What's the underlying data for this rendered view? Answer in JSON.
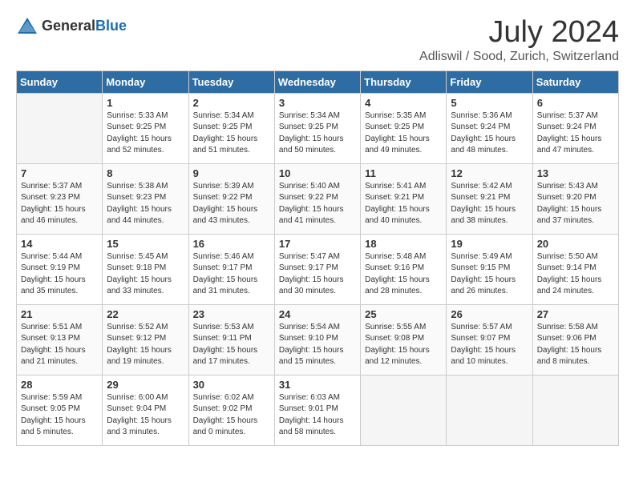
{
  "header": {
    "logo_general": "General",
    "logo_blue": "Blue",
    "month": "July 2024",
    "location": "Adliswil / Sood, Zurich, Switzerland"
  },
  "days_of_week": [
    "Sunday",
    "Monday",
    "Tuesday",
    "Wednesday",
    "Thursday",
    "Friday",
    "Saturday"
  ],
  "weeks": [
    [
      {
        "day": "",
        "info": ""
      },
      {
        "day": "1",
        "info": "Sunrise: 5:33 AM\nSunset: 9:25 PM\nDaylight: 15 hours\nand 52 minutes."
      },
      {
        "day": "2",
        "info": "Sunrise: 5:34 AM\nSunset: 9:25 PM\nDaylight: 15 hours\nand 51 minutes."
      },
      {
        "day": "3",
        "info": "Sunrise: 5:34 AM\nSunset: 9:25 PM\nDaylight: 15 hours\nand 50 minutes."
      },
      {
        "day": "4",
        "info": "Sunrise: 5:35 AM\nSunset: 9:25 PM\nDaylight: 15 hours\nand 49 minutes."
      },
      {
        "day": "5",
        "info": "Sunrise: 5:36 AM\nSunset: 9:24 PM\nDaylight: 15 hours\nand 48 minutes."
      },
      {
        "day": "6",
        "info": "Sunrise: 5:37 AM\nSunset: 9:24 PM\nDaylight: 15 hours\nand 47 minutes."
      }
    ],
    [
      {
        "day": "7",
        "info": "Sunrise: 5:37 AM\nSunset: 9:23 PM\nDaylight: 15 hours\nand 46 minutes."
      },
      {
        "day": "8",
        "info": "Sunrise: 5:38 AM\nSunset: 9:23 PM\nDaylight: 15 hours\nand 44 minutes."
      },
      {
        "day": "9",
        "info": "Sunrise: 5:39 AM\nSunset: 9:22 PM\nDaylight: 15 hours\nand 43 minutes."
      },
      {
        "day": "10",
        "info": "Sunrise: 5:40 AM\nSunset: 9:22 PM\nDaylight: 15 hours\nand 41 minutes."
      },
      {
        "day": "11",
        "info": "Sunrise: 5:41 AM\nSunset: 9:21 PM\nDaylight: 15 hours\nand 40 minutes."
      },
      {
        "day": "12",
        "info": "Sunrise: 5:42 AM\nSunset: 9:21 PM\nDaylight: 15 hours\nand 38 minutes."
      },
      {
        "day": "13",
        "info": "Sunrise: 5:43 AM\nSunset: 9:20 PM\nDaylight: 15 hours\nand 37 minutes."
      }
    ],
    [
      {
        "day": "14",
        "info": "Sunrise: 5:44 AM\nSunset: 9:19 PM\nDaylight: 15 hours\nand 35 minutes."
      },
      {
        "day": "15",
        "info": "Sunrise: 5:45 AM\nSunset: 9:18 PM\nDaylight: 15 hours\nand 33 minutes."
      },
      {
        "day": "16",
        "info": "Sunrise: 5:46 AM\nSunset: 9:17 PM\nDaylight: 15 hours\nand 31 minutes."
      },
      {
        "day": "17",
        "info": "Sunrise: 5:47 AM\nSunset: 9:17 PM\nDaylight: 15 hours\nand 30 minutes."
      },
      {
        "day": "18",
        "info": "Sunrise: 5:48 AM\nSunset: 9:16 PM\nDaylight: 15 hours\nand 28 minutes."
      },
      {
        "day": "19",
        "info": "Sunrise: 5:49 AM\nSunset: 9:15 PM\nDaylight: 15 hours\nand 26 minutes."
      },
      {
        "day": "20",
        "info": "Sunrise: 5:50 AM\nSunset: 9:14 PM\nDaylight: 15 hours\nand 24 minutes."
      }
    ],
    [
      {
        "day": "21",
        "info": "Sunrise: 5:51 AM\nSunset: 9:13 PM\nDaylight: 15 hours\nand 21 minutes."
      },
      {
        "day": "22",
        "info": "Sunrise: 5:52 AM\nSunset: 9:12 PM\nDaylight: 15 hours\nand 19 minutes."
      },
      {
        "day": "23",
        "info": "Sunrise: 5:53 AM\nSunset: 9:11 PM\nDaylight: 15 hours\nand 17 minutes."
      },
      {
        "day": "24",
        "info": "Sunrise: 5:54 AM\nSunset: 9:10 PM\nDaylight: 15 hours\nand 15 minutes."
      },
      {
        "day": "25",
        "info": "Sunrise: 5:55 AM\nSunset: 9:08 PM\nDaylight: 15 hours\nand 12 minutes."
      },
      {
        "day": "26",
        "info": "Sunrise: 5:57 AM\nSunset: 9:07 PM\nDaylight: 15 hours\nand 10 minutes."
      },
      {
        "day": "27",
        "info": "Sunrise: 5:58 AM\nSunset: 9:06 PM\nDaylight: 15 hours\nand 8 minutes."
      }
    ],
    [
      {
        "day": "28",
        "info": "Sunrise: 5:59 AM\nSunset: 9:05 PM\nDaylight: 15 hours\nand 5 minutes."
      },
      {
        "day": "29",
        "info": "Sunrise: 6:00 AM\nSunset: 9:04 PM\nDaylight: 15 hours\nand 3 minutes."
      },
      {
        "day": "30",
        "info": "Sunrise: 6:02 AM\nSunset: 9:02 PM\nDaylight: 15 hours\nand 0 minutes."
      },
      {
        "day": "31",
        "info": "Sunrise: 6:03 AM\nSunset: 9:01 PM\nDaylight: 14 hours\nand 58 minutes."
      },
      {
        "day": "",
        "info": ""
      },
      {
        "day": "",
        "info": ""
      },
      {
        "day": "",
        "info": ""
      }
    ]
  ]
}
